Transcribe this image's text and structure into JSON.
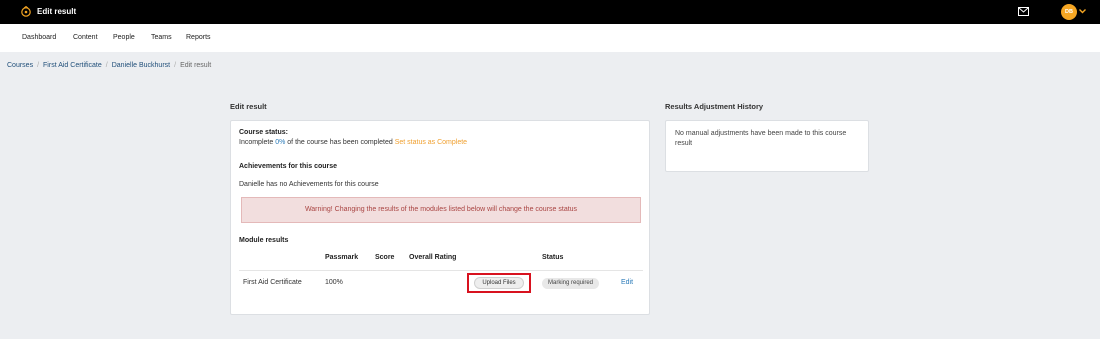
{
  "topbar": {
    "title": "Edit result",
    "avatar_initials": "DB",
    "avatar_color": "#f5a623",
    "logo_icon": "logo-icon",
    "mail_icon": "mail-icon",
    "chevron_icon": "chevron-down-icon"
  },
  "nav": {
    "items": [
      "Dashboard",
      "Content",
      "People",
      "Teams",
      "Reports"
    ]
  },
  "breadcrumb": {
    "items": [
      "Courses",
      "First Aid Certificate",
      "Danielle Buckhurst"
    ],
    "current": "Edit result"
  },
  "main": {
    "title": "Edit result",
    "course_status_label": "Course status:",
    "status_prefix": "Incomplete",
    "status_percent": "0%",
    "status_suffix": "of the course has been completed",
    "set_status_link": "Set status as Complete",
    "achievements_title": "Achievements for this course",
    "achievements_text": "Danielle has no Achievements for this course",
    "warning_text": "Warning! Changing the results of the modules listed below will change the course status",
    "module_results_title": "Module results",
    "table": {
      "headers": {
        "passmark": "Passmark",
        "score": "Score",
        "overall_rating": "Overall Rating",
        "status": "Status"
      },
      "rows": [
        {
          "module": "First Aid Certificate",
          "passmark": "100%",
          "upload_label": "Upload Files",
          "status": "Marking required",
          "edit_label": "Edit"
        }
      ]
    }
  },
  "history": {
    "title": "Results Adjustment History",
    "text": "No manual adjustments have been made to this course result"
  },
  "colors": {
    "topbar": "#000000",
    "accent_orange": "#f0a030",
    "link_blue": "#2a7ab8",
    "warning_bg": "#f2dede",
    "warning_text": "#a94442",
    "highlight": "#d8121f"
  }
}
